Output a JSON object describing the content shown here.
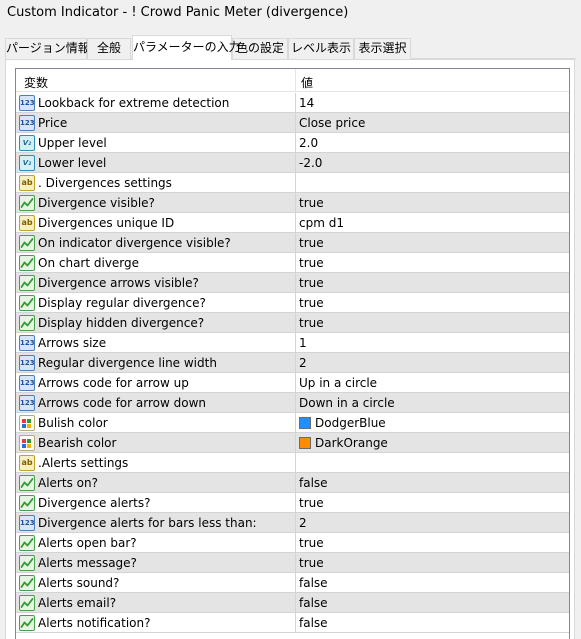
{
  "window": {
    "title": "Custom Indicator - ! Crowd Panic Meter (divergence)"
  },
  "tabs": [
    {
      "label": "パージョン情報",
      "active": false
    },
    {
      "label": "全般",
      "active": false
    },
    {
      "label": "パラメーターの入力",
      "active": true
    },
    {
      "label": "色の設定",
      "active": false
    },
    {
      "label": "レベル表示",
      "active": false
    },
    {
      "label": "表示選択",
      "active": false
    }
  ],
  "grid": {
    "headers": {
      "variable": "変数",
      "value": "値"
    },
    "rows": [
      {
        "type": "int",
        "name": "Lookback for extreme detection",
        "value": "14"
      },
      {
        "type": "int",
        "name": "Price",
        "value": "Close price"
      },
      {
        "type": "dbl",
        "name": "Upper level",
        "value": "2.0"
      },
      {
        "type": "dbl",
        "name": "Lower level",
        "value": "-2.0"
      },
      {
        "type": "str",
        "name": ".   Divergences settings",
        "value": ""
      },
      {
        "type": "bool",
        "name": "Divergence visible?",
        "value": "true"
      },
      {
        "type": "str",
        "name": "Divergences unique ID",
        "value": "cpm d1"
      },
      {
        "type": "bool",
        "name": "On indicator divergence visible?",
        "value": "true"
      },
      {
        "type": "bool",
        "name": "On chart diverge",
        "value": "true"
      },
      {
        "type": "bool",
        "name": "Divergence arrows visible?",
        "value": "true"
      },
      {
        "type": "bool",
        "name": "Display regular divergence?",
        "value": "true"
      },
      {
        "type": "bool",
        "name": "Display hidden divergence?",
        "value": "true"
      },
      {
        "type": "int",
        "name": "Arrows size",
        "value": "1"
      },
      {
        "type": "int",
        "name": "Regular divergence line width",
        "value": "2"
      },
      {
        "type": "int",
        "name": "Arrows code for arrow up",
        "value": "Up in a circle"
      },
      {
        "type": "int",
        "name": "Arrows code for arrow down",
        "value": "Down in a circle"
      },
      {
        "type": "col",
        "name": "Bulish color",
        "value": "DodgerBlue",
        "swatch": "#1e90ff"
      },
      {
        "type": "col",
        "name": "Bearish color",
        "value": "DarkOrange",
        "swatch": "#ff8c00"
      },
      {
        "type": "str",
        "name": ".Alerts settings",
        "value": ""
      },
      {
        "type": "bool",
        "name": "Alerts on?",
        "value": "false"
      },
      {
        "type": "bool",
        "name": "Divergence alerts?",
        "value": "true"
      },
      {
        "type": "int",
        "name": "Divergence alerts for bars less than:",
        "value": "2"
      },
      {
        "type": "bool",
        "name": "Alerts open bar?",
        "value": "true"
      },
      {
        "type": "bool",
        "name": "Alerts message?",
        "value": "true"
      },
      {
        "type": "bool",
        "name": "Alerts sound?",
        "value": "false"
      },
      {
        "type": "bool",
        "name": "Alerts email?",
        "value": "false"
      },
      {
        "type": "bool",
        "name": "Alerts notification?",
        "value": "false"
      }
    ]
  },
  "icon_names": {
    "int": "integer-type-icon",
    "dbl": "double-type-icon",
    "str": "string-type-icon",
    "bool": "boolean-type-icon",
    "col": "color-type-icon"
  },
  "icon_glyphs": {
    "int": "123",
    "dbl": "V₂",
    "str": "ab"
  }
}
